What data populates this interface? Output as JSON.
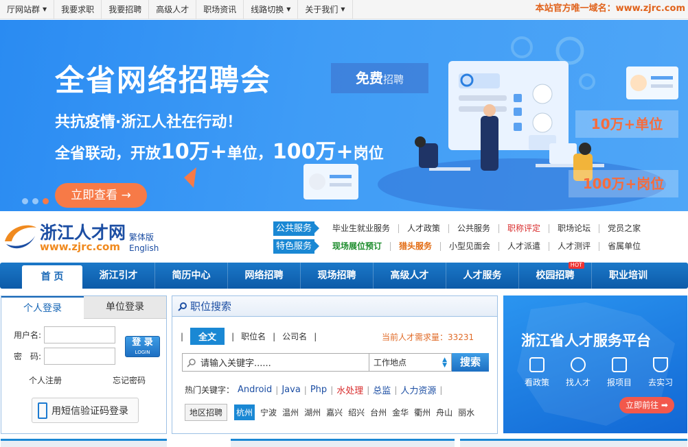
{
  "topbar": {
    "items": [
      {
        "label": "厅网站群",
        "dropdown": true
      },
      {
        "label": "我要求职",
        "dropdown": false
      },
      {
        "label": "我要招聘",
        "dropdown": false
      },
      {
        "label": "高级人才",
        "dropdown": false
      },
      {
        "label": "职场资讯",
        "dropdown": false
      },
      {
        "label": "线路切换",
        "dropdown": true
      },
      {
        "label": "关于我们",
        "dropdown": true
      }
    ],
    "domain_note": "本站官方唯一域名：www.zjrc.com"
  },
  "banner": {
    "title": "全省网络招聘会",
    "line1": "共抗疫情·浙江人社在行动！",
    "line2_a": "全省联动，开放",
    "line2_b": "10万+",
    "line2_c": "单位，",
    "line2_d": "100万+",
    "line2_e": "岗位",
    "cta": "立即查看 →",
    "free_a": "免费",
    "free_b": "招聘",
    "units_tag": "10万+单位",
    "jobs_tag": "100万+岗位"
  },
  "logo": {
    "name": "浙江人才网",
    "url": "www.zjrc.com",
    "traditional": "繁体版",
    "english": "English"
  },
  "services": {
    "public_label": "公共服务",
    "public_links": [
      {
        "label": "毕业生就业服务",
        "style": ""
      },
      {
        "label": "人才政策",
        "style": ""
      },
      {
        "label": "公共服务",
        "style": ""
      },
      {
        "label": "职称评定",
        "style": "red"
      },
      {
        "label": "职场论坛",
        "style": ""
      },
      {
        "label": "党员之家",
        "style": ""
      }
    ],
    "special_label": "特色服务",
    "special_links": [
      {
        "label": "现场展位预订",
        "style": "green"
      },
      {
        "label": "猎头服务",
        "style": "orange"
      },
      {
        "label": "小型见面会",
        "style": ""
      },
      {
        "label": "人才派遣",
        "style": ""
      },
      {
        "label": "人才测评",
        "style": ""
      },
      {
        "label": "省属单位",
        "style": ""
      }
    ]
  },
  "mainnav": {
    "items": [
      {
        "label": "首  页",
        "active": true,
        "hot": false
      },
      {
        "label": "浙江引才",
        "active": false,
        "hot": false
      },
      {
        "label": "简历中心",
        "active": false,
        "hot": false
      },
      {
        "label": "网络招聘",
        "active": false,
        "hot": false
      },
      {
        "label": "现场招聘",
        "active": false,
        "hot": false
      },
      {
        "label": "高级人才",
        "active": false,
        "hot": false
      },
      {
        "label": "人才服务",
        "active": false,
        "hot": false
      },
      {
        "label": "校园招聘",
        "active": false,
        "hot": true
      },
      {
        "label": "职业培训",
        "active": false,
        "hot": false
      }
    ],
    "hot_label": "HOT"
  },
  "login": {
    "tab_personal": "个人登录",
    "tab_company": "单位登录",
    "username_label": "用户名:",
    "password_label": "密　码:",
    "login_btn": "登 录",
    "login_btn_sub": "LOGIN",
    "register": "个人注册",
    "forgot": "忘记密码",
    "sms_login": "用短信验证码登录"
  },
  "search": {
    "header": "职位搜索",
    "tabs": [
      "全文",
      "职位名",
      "公司名"
    ],
    "demand_label": "当前人才需求量：",
    "demand_value": "33231",
    "placeholder": "请输入关键字......",
    "location": "工作地点",
    "go": "搜索",
    "hot_label": "热门关键字：",
    "hot_keywords": [
      {
        "label": "Android",
        "style": ""
      },
      {
        "label": "Java",
        "style": ""
      },
      {
        "label": "Php",
        "style": ""
      },
      {
        "label": "水处理",
        "style": "red"
      },
      {
        "label": "总监",
        "style": ""
      },
      {
        "label": "人力资源",
        "style": ""
      }
    ],
    "area_label": "地区招聘",
    "areas": [
      "杭州",
      "宁波",
      "温州",
      "湖州",
      "嘉兴",
      "绍兴",
      "台州",
      "金华",
      "衢州",
      "舟山",
      "丽水"
    ]
  },
  "platform": {
    "title": "浙江省人才服务平台",
    "items": [
      "看政策",
      "找人才",
      "报项目",
      "去实习"
    ],
    "go": "立即前往 ➡"
  },
  "colors": {
    "brand_blue": "#1a88d4",
    "nav_blue": "#0c5aa8",
    "accent_orange": "#f77a47"
  }
}
